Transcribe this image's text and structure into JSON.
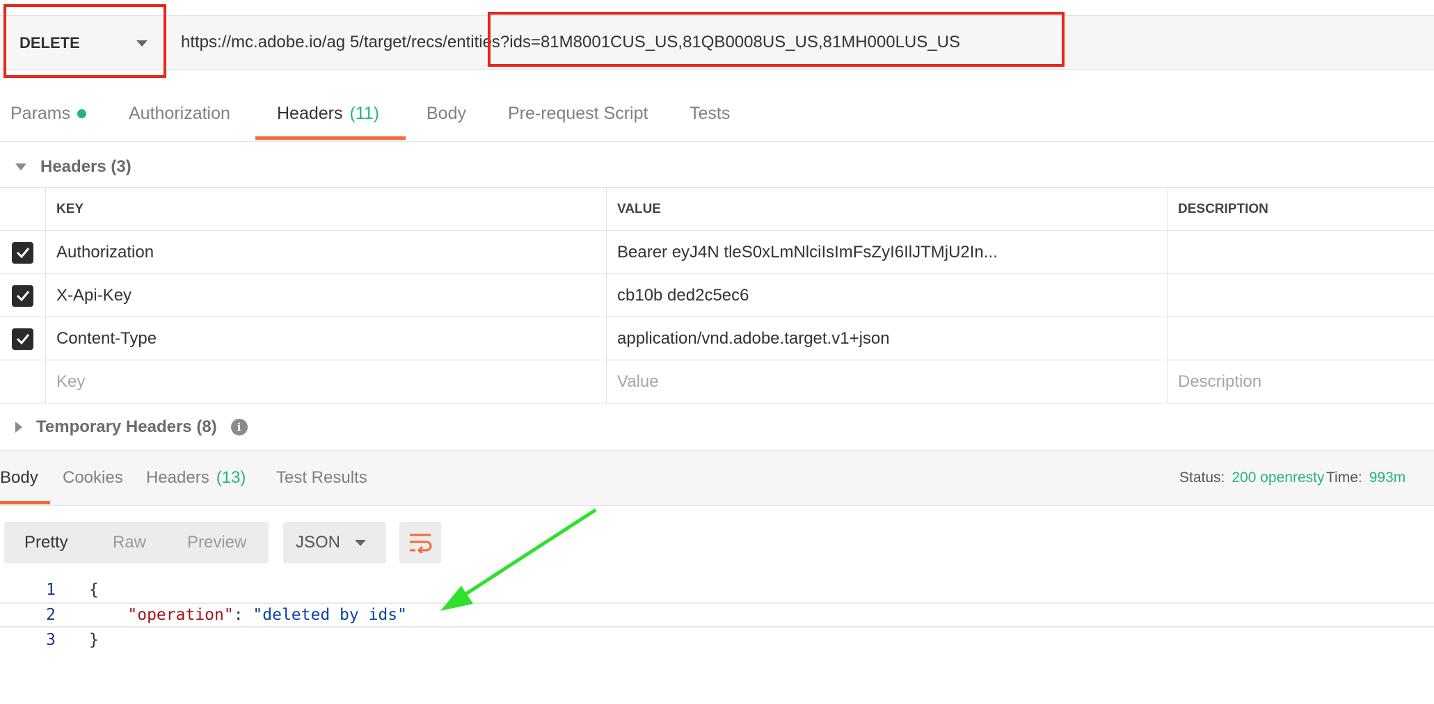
{
  "request": {
    "method": "DELETE",
    "url": "https://mc.adobe.io/ag   5/target/recs/entities?ids=81M8001CUS_US,81QB0008US_US,81MH000LUS_US"
  },
  "request_tabs": [
    {
      "label": "Params",
      "count": ""
    },
    {
      "label": "Authorization",
      "count": ""
    },
    {
      "label": "Headers",
      "count": "(11)"
    },
    {
      "label": "Body",
      "count": ""
    },
    {
      "label": "Pre-request Script",
      "count": ""
    },
    {
      "label": "Tests",
      "count": ""
    }
  ],
  "headers_section": {
    "title": "Headers (3)",
    "columns": {
      "key": "KEY",
      "value": "VALUE",
      "description": "DESCRIPTION"
    },
    "rows": [
      {
        "key": "Authorization",
        "value": "Bearer eyJ4N                      tleS0xLmNlciIsImFsZyI6IlJTMjU2In...",
        "description": ""
      },
      {
        "key": "X-Api-Key",
        "value": "cb10b                           ded2c5ec6",
        "description": ""
      },
      {
        "key": "Content-Type",
        "value": "application/vnd.adobe.target.v1+json",
        "description": ""
      }
    ],
    "placeholders": {
      "key": "Key",
      "value": "Value",
      "description": "Description"
    }
  },
  "temporary_headers": {
    "label": "Temporary Headers (8)",
    "icon": "info-icon"
  },
  "response_tabs": [
    {
      "label": "Body",
      "count": ""
    },
    {
      "label": "Cookies",
      "count": ""
    },
    {
      "label": "Headers",
      "count": "(13)"
    },
    {
      "label": "Test Results",
      "count": ""
    }
  ],
  "response_status": {
    "status_label": "Status:",
    "status_value": "200 openresty",
    "time_label": "Time:",
    "time_value": "993m"
  },
  "view_modes": [
    "Pretty",
    "Raw",
    "Preview"
  ],
  "format": "JSON",
  "code": {
    "line_numbers": [
      "1",
      "2",
      "3"
    ],
    "open_brace": "{",
    "key": "\"operation\"",
    "colon": ": ",
    "value": "\"deleted by ids\"",
    "close_brace": "}"
  },
  "colors": {
    "accent_orange": "#f26b3a",
    "success_green": "#26b47f",
    "annotation_red": "#e8261c",
    "annotation_arrow_green": "#2fe02f"
  }
}
